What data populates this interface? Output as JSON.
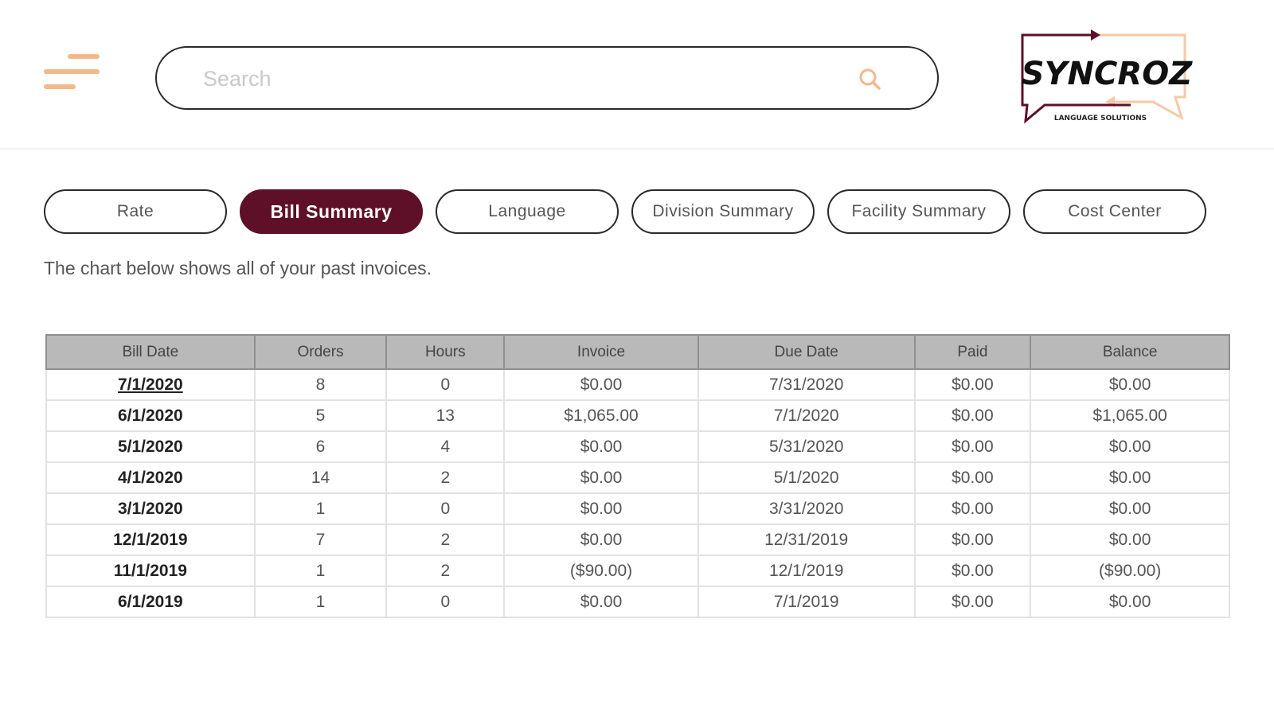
{
  "header": {
    "menu_icon": "hamburger-menu-icon",
    "search": {
      "placeholder": "Search",
      "value": "",
      "icon": "search-icon"
    },
    "logo": {
      "name": "SYNCROZ",
      "tagline": "LANGUAGE SOLUTIONS"
    }
  },
  "tabs": [
    {
      "label": "Rate",
      "active": false
    },
    {
      "label": "Bill Summary",
      "active": true
    },
    {
      "label": "Language",
      "active": false
    },
    {
      "label": "Division Summary",
      "active": false
    },
    {
      "label": "Facility Summary",
      "active": false
    },
    {
      "label": "Cost Center",
      "active": false
    }
  ],
  "intro_text": "The chart below shows all of your past invoices.",
  "table": {
    "columns": [
      "Bill Date",
      "Orders",
      "Hours",
      "Invoice",
      "Due Date",
      "Paid",
      "Balance"
    ],
    "rows": [
      [
        "7/1/2020",
        "8",
        "0",
        "$0.00",
        "7/31/2020",
        "$0.00",
        "$0.00"
      ],
      [
        "6/1/2020",
        "5",
        "13",
        "$1,065.00",
        "7/1/2020",
        "$0.00",
        "$1,065.00"
      ],
      [
        "5/1/2020",
        "6",
        "4",
        "$0.00",
        "5/31/2020",
        "$0.00",
        "$0.00"
      ],
      [
        "4/1/2020",
        "14",
        "2",
        "$0.00",
        "5/1/2020",
        "$0.00",
        "$0.00"
      ],
      [
        "3/1/2020",
        "1",
        "0",
        "$0.00",
        "3/31/2020",
        "$0.00",
        "$0.00"
      ],
      [
        "12/1/2019",
        "7",
        "2",
        "$0.00",
        "12/31/2019",
        "$0.00",
        "$0.00"
      ],
      [
        "11/1/2019",
        "1",
        "2",
        "($90.00)",
        "12/1/2019",
        "$0.00",
        "($90.00)"
      ],
      [
        "6/1/2019",
        "1",
        "0",
        "$0.00",
        "7/1/2019",
        "$0.00",
        "$0.00"
      ]
    ]
  },
  "colors": {
    "brand_maroon": "#5e1028",
    "accent_peach": "#f5b88a",
    "header_gray": "#b9b9b9"
  }
}
